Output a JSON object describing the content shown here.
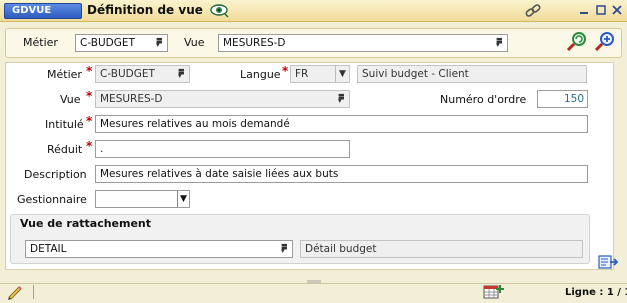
{
  "window": {
    "app_badge": "GDVUE",
    "title": "Définition de vue"
  },
  "toolbar": {
    "metier_label": "Métier",
    "metier_value": "C-BUDGET",
    "vue_label": "Vue",
    "vue_value": "MESURES-D"
  },
  "form": {
    "metier_label": "Métier",
    "metier_value": "C-BUDGET",
    "langue_label": "Langue",
    "langue_value": "FR",
    "langue_description": "Suivi budget - Client",
    "vue_label": "Vue",
    "vue_value": "MESURES-D",
    "numero_ordre_label": "Numéro d'ordre",
    "numero_ordre_value": "150",
    "intitule_label": "Intitulé",
    "intitule_value": "Mesures relatives au mois demandé",
    "reduit_label": "Réduit",
    "reduit_value": ".",
    "description_label": "Description",
    "description_value": "Mesures relatives à date saisie liées aux buts",
    "gestionnaire_label": "Gestionnaire",
    "gestionnaire_value": ""
  },
  "rattachement": {
    "title": "Vue de rattachement",
    "code": "DETAIL",
    "libelle": "Détail budget"
  },
  "status": {
    "ligne": "Ligne : 1 / 1"
  },
  "colors": {
    "accent": "#2d5cc0",
    "required": "#c00000",
    "window_bg": "#f3efd6"
  }
}
